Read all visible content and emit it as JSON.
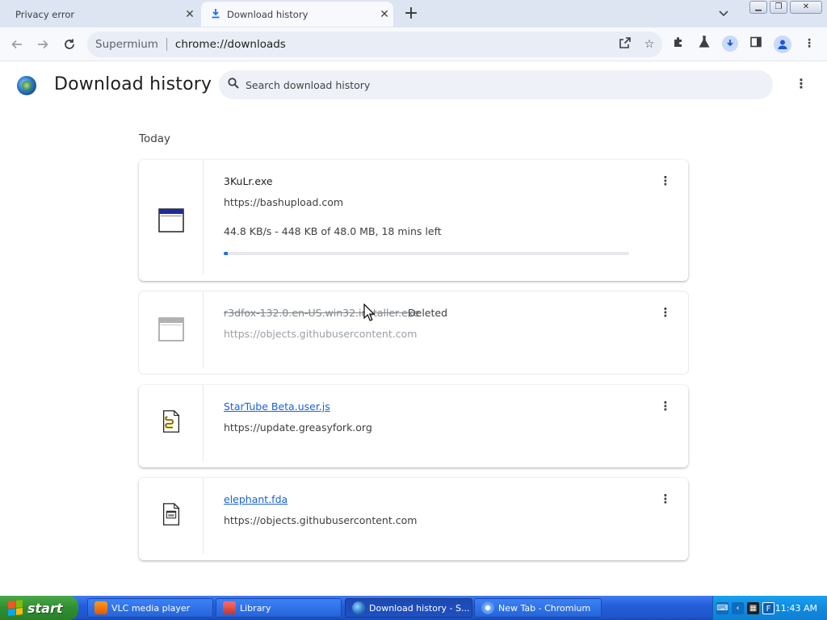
{
  "tabs": [
    {
      "title": "Privacy error",
      "active": false
    },
    {
      "title": "Download history",
      "active": true,
      "icon": "download-icon"
    }
  ],
  "toolbar": {
    "site_label": "Supermium",
    "url": "chrome://downloads"
  },
  "page": {
    "title": "Download history",
    "search_placeholder": "Search download history",
    "section_date": "Today"
  },
  "downloads": [
    {
      "filename": "3KuLr.exe",
      "url": "https://bashupload.com",
      "status": "44.8 KB/s - 448 KB of 48.0 MB, 18 mins left",
      "progress": 0.009,
      "state": "in-progress",
      "icon": "window-exe-icon"
    },
    {
      "filename": "r3dfox-132.0.en-US.win32.installer.exe",
      "tag": "Deleted",
      "url": "https://objects.githubusercontent.com",
      "state": "deleted",
      "icon": "window-exe-icon"
    },
    {
      "filename": "StarTube Beta.user.js",
      "url": "https://update.greasyfork.org",
      "state": "complete",
      "icon": "script-file-icon"
    },
    {
      "filename": "elephant.fda",
      "url": "https://objects.githubusercontent.com",
      "state": "complete",
      "icon": "generic-file-icon"
    }
  ],
  "taskbar": {
    "start_label": "start",
    "items": [
      {
        "label": "VLC media player",
        "active": false,
        "icon": "vlc-icon"
      },
      {
        "label": "Library",
        "active": false,
        "icon": "library-icon"
      },
      {
        "label": "Download history - S...",
        "active": true,
        "icon": "supermium-icon"
      },
      {
        "label": "New Tab - Chromium",
        "active": false,
        "icon": "chromium-icon"
      }
    ],
    "clock": "11:43 AM"
  },
  "colors": {
    "accent": "#1a73e8",
    "link": "#1a62d6",
    "tabstrip": "#dde5f3",
    "taskbar": "#245edb"
  }
}
